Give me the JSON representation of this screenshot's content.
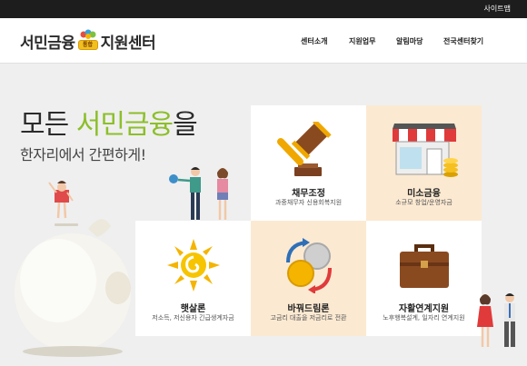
{
  "topbar": {
    "sitemap_label": "사이트맵"
  },
  "logo": {
    "part1": "서민금융",
    "badge": "통합",
    "part2": "지원센터"
  },
  "nav": {
    "items": [
      "센터소개",
      "지원업무",
      "알림마당",
      "전국센터찾기"
    ]
  },
  "hero": {
    "title_prefix": "모든 ",
    "title_accent": "서민금융",
    "title_suffix": "을",
    "subtitle": "한자리에서 간편하게!"
  },
  "services": [
    {
      "title": "채무조정",
      "desc": "과중채무자 신용회복지원"
    },
    {
      "title": "미소금융",
      "desc": "소규모 창업/운영자금"
    },
    {
      "title": "햇살론",
      "desc": "저소득, 저신용자 긴급생계자금"
    },
    {
      "title": "바꿔드림론",
      "desc": "고금리 대출을 저금리로 전환"
    },
    {
      "title": "자활연계지원",
      "desc": "노후행복설계, 일자리 연계지원"
    }
  ],
  "colors": {
    "accent_green": "#8cbf2a",
    "tile_beige": "#fbe9d1",
    "topbar": "#1d1d1d"
  }
}
